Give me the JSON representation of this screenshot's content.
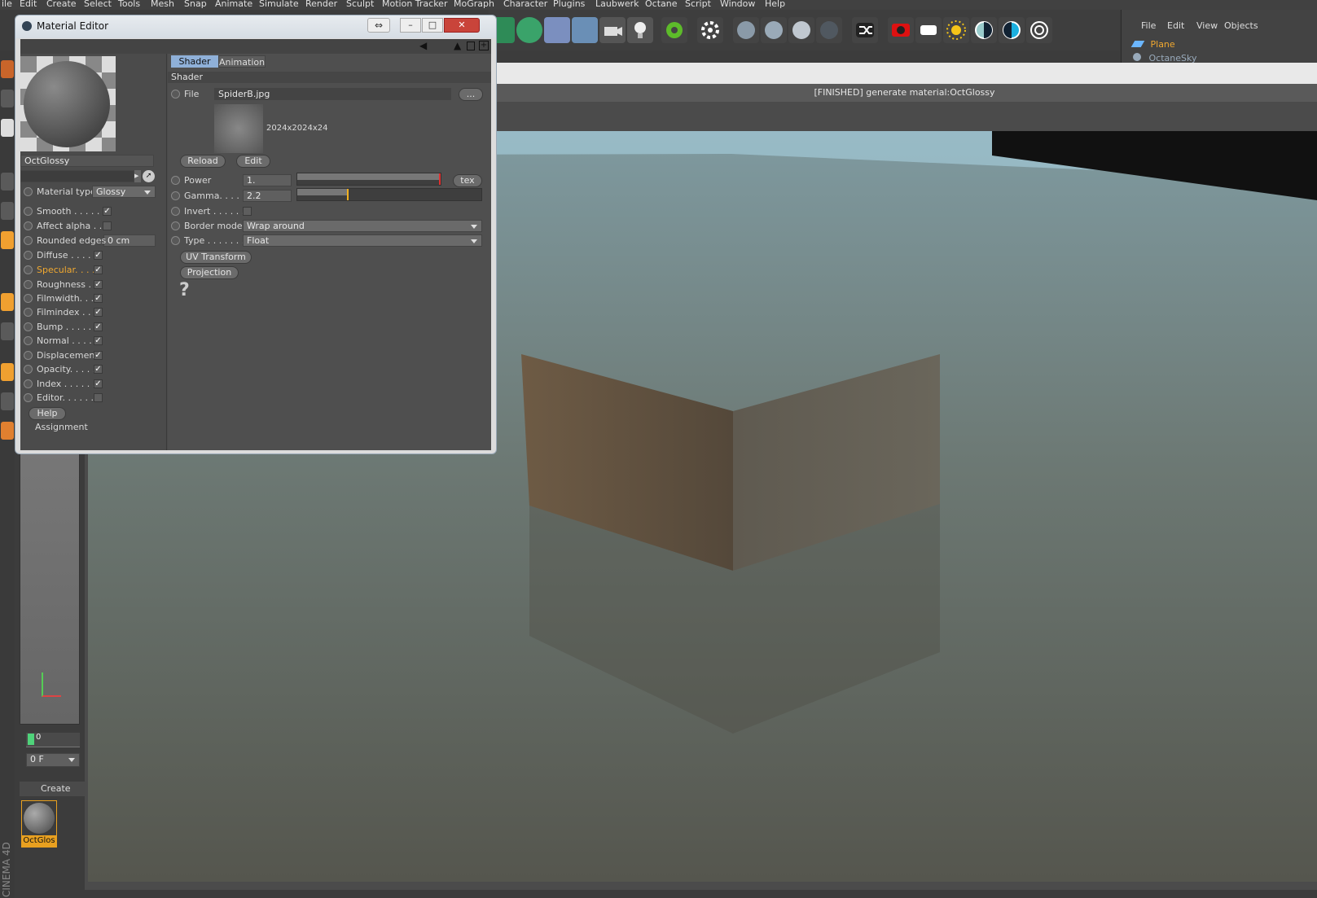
{
  "menubar": {
    "items": [
      "ile",
      "Edit",
      "Create",
      "Select",
      "Tools",
      "Mesh",
      "Snap",
      "Animate",
      "Simulate",
      "Render",
      "Sculpt",
      "Motion Tracker",
      "MoGraph",
      "Character",
      "Plugins",
      "Laubwerk",
      "Octane",
      "Script",
      "Window",
      "Help"
    ]
  },
  "objects_panel": {
    "menu": [
      "File",
      "Edit",
      "View",
      "Objects"
    ],
    "items": [
      {
        "label": "Plane",
        "color": "#f0a830"
      },
      {
        "label": "OctaneSky",
        "color": "#9ab"
      }
    ]
  },
  "viewport": {
    "status": "[FINISHED] generate material:OctGlossy"
  },
  "timeline": {
    "frame_label": "0",
    "frame_field": "0 F"
  },
  "material_manager": {
    "create_label": "Create",
    "material_name": "OctGlos"
  },
  "brand": "CINEMA 4D",
  "material_editor": {
    "title": "Material Editor",
    "material_name": "OctGlossy",
    "material_type_label": "Material type",
    "material_type_value": "Glossy",
    "channels": [
      {
        "label": "Smooth . . . . . .",
        "checked": true,
        "highlight": false
      },
      {
        "label": "Affect alpha . . .",
        "checked": false,
        "highlight": false
      },
      {
        "label": "Diffuse . . . . .",
        "checked": true,
        "highlight": false
      },
      {
        "label": "Specular. . . .",
        "checked": true,
        "highlight": true
      },
      {
        "label": "Roughness . .",
        "checked": true,
        "highlight": false
      },
      {
        "label": "Filmwidth. . .",
        "checked": true,
        "highlight": false
      },
      {
        "label": "Filmindex . . .",
        "checked": true,
        "highlight": false
      },
      {
        "label": "Bump . . . . . .",
        "checked": true,
        "highlight": false
      },
      {
        "label": "Normal . . . . .",
        "checked": true,
        "highlight": false
      },
      {
        "label": "Displacement",
        "checked": true,
        "highlight": false
      },
      {
        "label": "Opacity. . . . .",
        "checked": true,
        "highlight": false
      },
      {
        "label": "Index . . . . . .",
        "checked": true,
        "highlight": false
      },
      {
        "label": "Editor. . . . . .",
        "checked": false,
        "highlight": false
      }
    ],
    "rounded_edges_label": "Rounded edges",
    "rounded_edges_value": "0 cm",
    "help_label": "Help",
    "assignment_label": "Assignment",
    "tabs": [
      "Shader",
      "Animation"
    ],
    "section_title": "Shader",
    "file_label": "File",
    "file_value": "SpiderB.jpg",
    "file_browse": "...",
    "image_info": "2024x2024x24",
    "reload_label": "Reload",
    "edit_label": "Edit",
    "power_label": "Power",
    "power_value": "1.",
    "power_fraction": 1.0,
    "tex_label": "tex",
    "gamma_label": "Gamma. . . . .",
    "gamma_value": "2.2",
    "gamma_fraction": 0.27,
    "invert_label": "Invert . . . . . .",
    "border_mode_label": "Border mode",
    "border_mode_value": "Wrap around",
    "type_label": "Type . . . . . . .",
    "type_value": "Float",
    "uv_transform_label": "UV Transform",
    "projection_label": "Projection",
    "help_glyph": "?"
  }
}
